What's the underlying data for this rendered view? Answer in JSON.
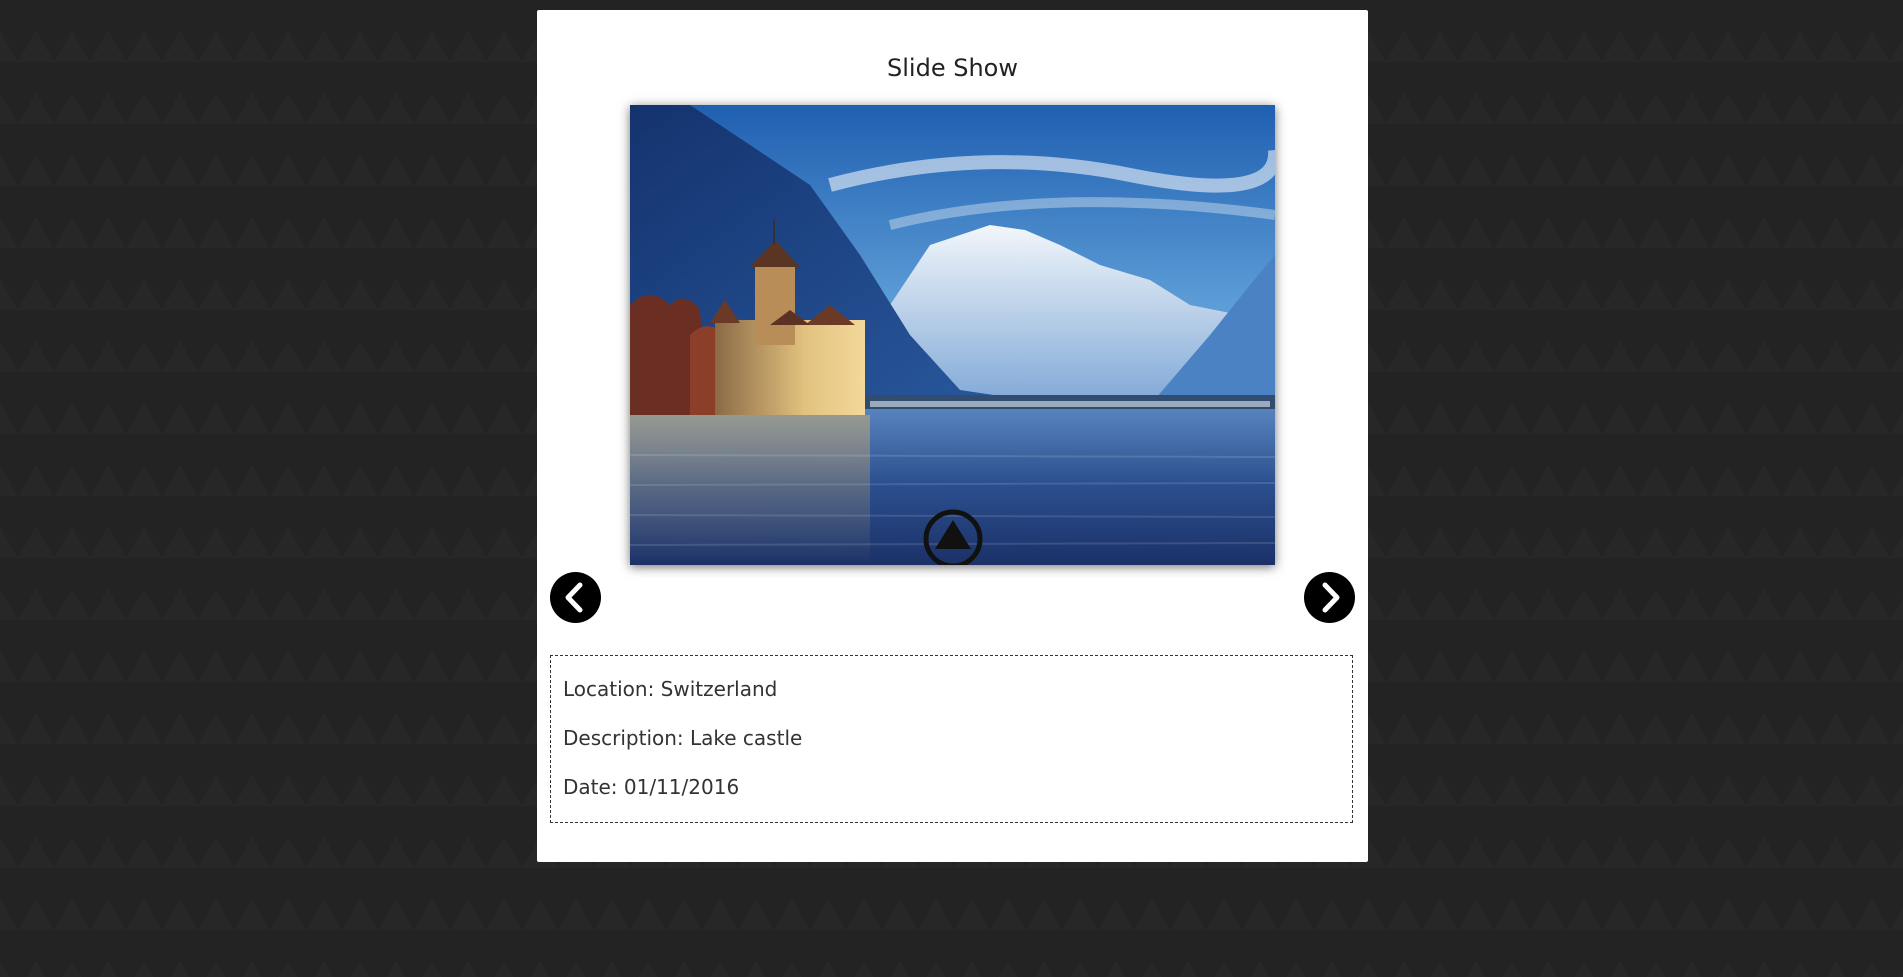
{
  "slideshow": {
    "title": "Slide Show",
    "image_alt": "Lake castle in Switzerland",
    "play_icon": "play-up-triangle-icon",
    "prev_icon": "chevron-left-icon",
    "next_icon": "chevron-right-icon"
  },
  "info": {
    "location": "Location: Switzerland",
    "description": "Description: Lake castle",
    "date": "Date: 01/11/2016"
  },
  "colors": {
    "background": "#232323",
    "card": "#ffffff",
    "button": "#000000"
  }
}
